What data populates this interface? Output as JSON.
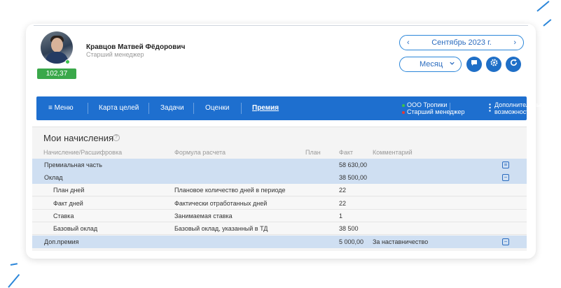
{
  "user": {
    "name": "Кравцов Матвей Фёдорович",
    "role": "Старший менеджер",
    "score": "102,37"
  },
  "period": {
    "month_label": "Сентябрь 2023 г.",
    "prev_icon": "‹",
    "next_icon": "›",
    "period_type": "Месяц"
  },
  "icons": [
    "chat-icon",
    "gear-icon",
    "refresh-icon",
    "chevron-down-icon",
    "help-icon",
    "menu-icon"
  ],
  "navbar": {
    "menu_label": "≡ Меню",
    "items": [
      "Карта целей",
      "Задачи",
      "Оценки",
      "Премия"
    ],
    "active": "Премия",
    "org_name": "ООО Тропики",
    "org_role": "Старший менеджер",
    "more_line1": "Дополнительные",
    "more_line2": "возможности"
  },
  "colors": {
    "accent": "#1e6fcf",
    "score_bg": "#3aa84a",
    "org_dot": "#3cc24a",
    "role_dot": "#e53935",
    "group_row": "#cfdff2"
  },
  "accruals": {
    "title": "Мои начисления",
    "columns": [
      "Начисление/Расшифровка",
      "Формула расчета",
      "План",
      "Факт",
      "Комментарий"
    ],
    "rows": [
      {
        "name": "Премиальная часть",
        "formula": "",
        "plan": "",
        "fact": "58 630,00",
        "comment": "",
        "toggle": "≡"
      },
      {
        "name": "Оклад",
        "formula": "",
        "plan": "",
        "fact": "38 500,00",
        "comment": "",
        "toggle": "−"
      },
      {
        "name": "План дней",
        "formula": "Плановое количество дней в периоде",
        "plan": "",
        "fact": "22",
        "comment": ""
      },
      {
        "name": "Факт дней",
        "formula": "Фактически отработанных дней",
        "plan": "",
        "fact": "22",
        "comment": ""
      },
      {
        "name": "Ставка",
        "formula": "Занимаемая ставка",
        "plan": "",
        "fact": "1",
        "comment": ""
      },
      {
        "name": "Базовый оклад",
        "formula": "Базовый оклад, указанный в ТД",
        "plan": "",
        "fact": "38 500",
        "comment": ""
      },
      {
        "name": "Доп.премия",
        "formula": "",
        "plan": "",
        "fact": "5 000,00",
        "comment": "За наставничество",
        "toggle": "−"
      }
    ]
  }
}
